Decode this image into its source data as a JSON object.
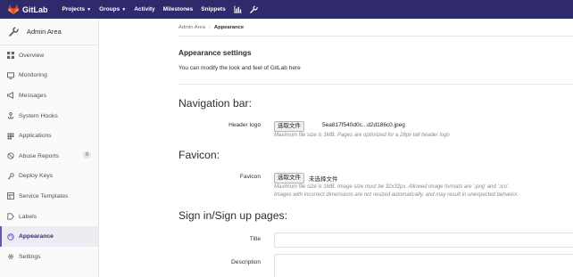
{
  "navbar": {
    "brand": "GitLab",
    "items": [
      {
        "label": "Projects",
        "has_dropdown": true
      },
      {
        "label": "Groups",
        "has_dropdown": true
      },
      {
        "label": "Activity"
      },
      {
        "label": "Milestones"
      },
      {
        "label": "Snippets"
      }
    ],
    "icons": [
      "chart-bar-icon",
      "wrench-icon"
    ],
    "background_color": "#2f2a6b",
    "logo_color": "#e24329"
  },
  "sidebar": {
    "title": "Admin Area",
    "items": [
      {
        "label": "Overview",
        "icon": "grid-icon"
      },
      {
        "label": "Monitoring",
        "icon": "monitor-icon"
      },
      {
        "label": "Messages",
        "icon": "megaphone-icon"
      },
      {
        "label": "System Hooks",
        "icon": "hook-icon"
      },
      {
        "label": "Applications",
        "icon": "applications-icon"
      },
      {
        "label": "Abuse Reports",
        "icon": "abuse-icon",
        "badge": "0"
      },
      {
        "label": "Deploy Keys",
        "icon": "key-icon"
      },
      {
        "label": "Service Templates",
        "icon": "template-icon"
      },
      {
        "label": "Labels",
        "icon": "label-icon"
      },
      {
        "label": "Appearance",
        "icon": "appearance-icon",
        "active": true
      },
      {
        "label": "Settings",
        "icon": "gear-icon"
      }
    ],
    "active_color": "#6b4fbb"
  },
  "breadcrumb": {
    "parent": "Admin Area",
    "separator": "›",
    "current": "Appearance"
  },
  "page": {
    "title": "Appearance settings",
    "description": "You can modify the look and feel of GitLab here"
  },
  "sections": {
    "navigation_bar": {
      "title": "Navigation bar:",
      "header_logo": {
        "label": "Header logo",
        "button": "选取文件",
        "file": "5ea817f540d0c...d2d186c0.jpeg",
        "help": "Maximum file size is 1MB. Pages are optimized for a 28px tall header logo"
      }
    },
    "favicon": {
      "title": "Favicon:",
      "field": {
        "label": "Favicon",
        "button": "选取文件",
        "file": "未选择文件",
        "help1": "Maximum file size is 1MB. Image size must be 32x32px. Allowed image formats are '.png' and '.ico'.",
        "help2": "Images with incorrect dimensions are not resized automatically, and may result in unexpected behavior."
      }
    },
    "sign_in": {
      "title": "Sign in/Sign up pages:",
      "title_label": "Title",
      "title_value": "",
      "description_label": "Description",
      "description_value": ""
    }
  }
}
